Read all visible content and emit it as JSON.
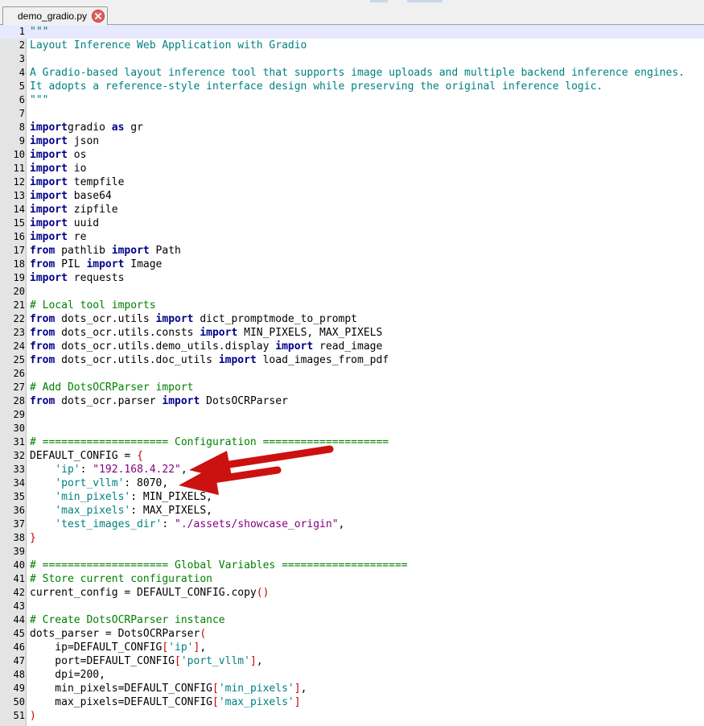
{
  "tab": {
    "filename": "demo_gradio.py"
  },
  "colors": {
    "keyword": "#00008b",
    "string": "#800080",
    "comment": "#008000",
    "docstring": "#008080",
    "bracket": "#cc0000",
    "arrow": "#cc1111"
  },
  "icons": {
    "tab_close": "close-icon",
    "annotation": "red-arrow-icon"
  },
  "lines": [
    {
      "n": "1",
      "t": [
        [
          "d",
          "\"\"\""
        ]
      ]
    },
    {
      "n": "2",
      "t": [
        [
          "d",
          "Layout Inference Web Application with Gradio"
        ]
      ]
    },
    {
      "n": "3",
      "t": []
    },
    {
      "n": "4",
      "t": [
        [
          "d",
          "A Gradio-based layout inference tool that supports image uploads and multiple backend inference engines."
        ]
      ]
    },
    {
      "n": "5",
      "t": [
        [
          "d",
          "It adopts a reference-style interface design while preserving the original inference logic."
        ]
      ]
    },
    {
      "n": "6",
      "t": [
        [
          "d",
          "\"\"\""
        ]
      ]
    },
    {
      "n": "7",
      "t": []
    },
    {
      "n": "8",
      "t": [
        [
          "k",
          "import"
        ],
        [
          "",
          "gradio "
        ],
        [
          "k",
          "as"
        ],
        [
          "",
          " gr"
        ]
      ]
    },
    {
      "n": "9",
      "t": [
        [
          "k",
          "import"
        ],
        [
          "",
          " json"
        ]
      ]
    },
    {
      "n": "10",
      "t": [
        [
          "k",
          "import"
        ],
        [
          "",
          " os"
        ]
      ]
    },
    {
      "n": "11",
      "t": [
        [
          "k",
          "import"
        ],
        [
          "",
          " io"
        ]
      ]
    },
    {
      "n": "12",
      "t": [
        [
          "k",
          "import"
        ],
        [
          "",
          " tempfile"
        ]
      ]
    },
    {
      "n": "13",
      "t": [
        [
          "k",
          "import"
        ],
        [
          "",
          " base64"
        ]
      ]
    },
    {
      "n": "14",
      "t": [
        [
          "k",
          "import"
        ],
        [
          "",
          " zipfile"
        ]
      ]
    },
    {
      "n": "15",
      "t": [
        [
          "k",
          "import"
        ],
        [
          "",
          " uuid"
        ]
      ]
    },
    {
      "n": "16",
      "t": [
        [
          "k",
          "import"
        ],
        [
          "",
          " re"
        ]
      ]
    },
    {
      "n": "17",
      "t": [
        [
          "k",
          "from"
        ],
        [
          "",
          " pathlib "
        ],
        [
          "k",
          "import"
        ],
        [
          "",
          " Path"
        ]
      ]
    },
    {
      "n": "18",
      "t": [
        [
          "k",
          "from"
        ],
        [
          "",
          " PIL "
        ],
        [
          "k",
          "import"
        ],
        [
          "",
          " Image"
        ]
      ]
    },
    {
      "n": "19",
      "t": [
        [
          "k",
          "import"
        ],
        [
          "",
          " requests"
        ]
      ]
    },
    {
      "n": "20",
      "t": []
    },
    {
      "n": "21",
      "t": [
        [
          "c",
          "# Local tool imports"
        ]
      ]
    },
    {
      "n": "22",
      "t": [
        [
          "k",
          "from"
        ],
        [
          "",
          " dots_ocr.utils "
        ],
        [
          "k",
          "import"
        ],
        [
          "",
          " dict_promptmode_to_prompt"
        ]
      ]
    },
    {
      "n": "23",
      "t": [
        [
          "k",
          "from"
        ],
        [
          "",
          " dots_ocr.utils.consts "
        ],
        [
          "k",
          "import"
        ],
        [
          "",
          " MIN_PIXELS, MAX_PIXELS"
        ]
      ]
    },
    {
      "n": "24",
      "t": [
        [
          "k",
          "from"
        ],
        [
          "",
          " dots_ocr.utils.demo_utils.display "
        ],
        [
          "k",
          "import"
        ],
        [
          "",
          " read_image"
        ]
      ]
    },
    {
      "n": "25",
      "t": [
        [
          "k",
          "from"
        ],
        [
          "",
          " dots_ocr.utils.doc_utils "
        ],
        [
          "k",
          "import"
        ],
        [
          "",
          " load_images_from_pdf"
        ]
      ]
    },
    {
      "n": "26",
      "t": []
    },
    {
      "n": "27",
      "t": [
        [
          "c",
          "# Add DotsOCRParser import"
        ]
      ]
    },
    {
      "n": "28",
      "t": [
        [
          "k",
          "from"
        ],
        [
          "",
          " dots_ocr.parser "
        ],
        [
          "k",
          "import"
        ],
        [
          "",
          " DotsOCRParser"
        ]
      ]
    },
    {
      "n": "29",
      "t": []
    },
    {
      "n": "30",
      "t": []
    },
    {
      "n": "31",
      "t": [
        [
          "c",
          "# ==================== Configuration ===================="
        ]
      ]
    },
    {
      "n": "32",
      "t": [
        [
          "",
          "DEFAULT_CONFIG = "
        ],
        [
          "p",
          "{"
        ]
      ]
    },
    {
      "n": "33",
      "t": [
        [
          "",
          "    "
        ],
        [
          "s",
          "'ip'"
        ],
        [
          "",
          ": "
        ],
        [
          "str",
          "\"192.168.4.22\""
        ],
        [
          "",
          ","
        ]
      ]
    },
    {
      "n": "34",
      "t": [
        [
          "",
          "    "
        ],
        [
          "s",
          "'port_vllm'"
        ],
        [
          "",
          ": 8070,"
        ]
      ]
    },
    {
      "n": "35",
      "t": [
        [
          "",
          "    "
        ],
        [
          "s",
          "'min_pixels'"
        ],
        [
          "",
          ": MIN_PIXELS,"
        ]
      ]
    },
    {
      "n": "36",
      "t": [
        [
          "",
          "    "
        ],
        [
          "s",
          "'max_pixels'"
        ],
        [
          "",
          ": MAX_PIXELS,"
        ]
      ]
    },
    {
      "n": "37",
      "t": [
        [
          "",
          "    "
        ],
        [
          "s",
          "'test_images_dir'"
        ],
        [
          "",
          ": "
        ],
        [
          "str",
          "\"./assets/showcase_origin\""
        ],
        [
          "",
          ","
        ]
      ]
    },
    {
      "n": "38",
      "t": [
        [
          "p",
          "}"
        ]
      ]
    },
    {
      "n": "39",
      "t": []
    },
    {
      "n": "40",
      "t": [
        [
          "c",
          "# ==================== Global Variables ===================="
        ]
      ]
    },
    {
      "n": "41",
      "t": [
        [
          "c",
          "# Store current configuration"
        ]
      ]
    },
    {
      "n": "42",
      "t": [
        [
          "",
          "current_config = DEFAULT_CONFIG.copy"
        ],
        [
          "p",
          "()"
        ]
      ]
    },
    {
      "n": "43",
      "t": []
    },
    {
      "n": "44",
      "t": [
        [
          "c",
          "# Create DotsOCRParser instance"
        ]
      ]
    },
    {
      "n": "45",
      "t": [
        [
          "",
          "dots_parser = DotsOCRParser"
        ],
        [
          "p",
          "("
        ]
      ]
    },
    {
      "n": "46",
      "t": [
        [
          "",
          "    ip=DEFAULT_CONFIG"
        ],
        [
          "p",
          "["
        ],
        [
          "s",
          "'ip'"
        ],
        [
          "p",
          "]"
        ],
        [
          "",
          ","
        ]
      ]
    },
    {
      "n": "47",
      "t": [
        [
          "",
          "    port=DEFAULT_CONFIG"
        ],
        [
          "p",
          "["
        ],
        [
          "s",
          "'port_vllm'"
        ],
        [
          "p",
          "]"
        ],
        [
          "",
          ","
        ]
      ]
    },
    {
      "n": "48",
      "t": [
        [
          "",
          "    dpi=200,"
        ]
      ]
    },
    {
      "n": "49",
      "t": [
        [
          "",
          "    min_pixels=DEFAULT_CONFIG"
        ],
        [
          "p",
          "["
        ],
        [
          "s",
          "'min_pixels'"
        ],
        [
          "p",
          "]"
        ],
        [
          "",
          ","
        ]
      ]
    },
    {
      "n": "50",
      "t": [
        [
          "",
          "    max_pixels=DEFAULT_CONFIG"
        ],
        [
          "p",
          "["
        ],
        [
          "s",
          "'max_pixels'"
        ],
        [
          "p",
          "]"
        ]
      ]
    },
    {
      "n": "51",
      "t": [
        [
          "p",
          ")"
        ]
      ]
    }
  ]
}
